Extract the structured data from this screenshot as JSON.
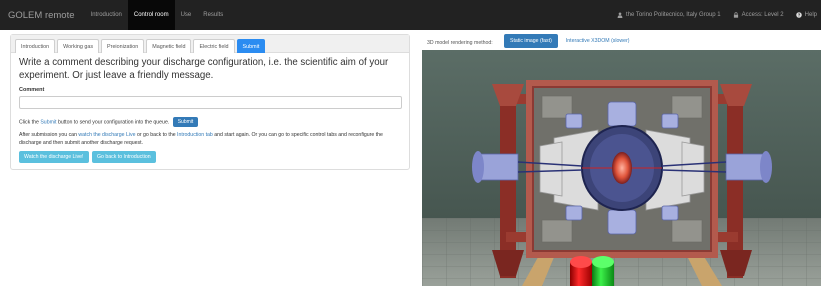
{
  "navbar": {
    "brand": "GOLEM remote",
    "items": [
      {
        "label": "Introduction",
        "active": false
      },
      {
        "label": "Control room",
        "active": true
      },
      {
        "label": "Use",
        "active": false
      },
      {
        "label": "Results",
        "active": false
      }
    ],
    "user": "the Torino Politecnico, Italy Group 1",
    "access": "Access: Level 2",
    "help": "Help",
    "user_icon": "user-icon",
    "access_icon": "lock-icon",
    "help_icon": "question-circle-icon"
  },
  "tabs": [
    {
      "label": "Introduction",
      "active": false
    },
    {
      "label": "Working gas",
      "active": false
    },
    {
      "label": "Preionization",
      "active": false
    },
    {
      "label": "Magnetic field",
      "active": false
    },
    {
      "label": "Electric field",
      "active": false
    },
    {
      "label": "Submit",
      "active": true
    }
  ],
  "form": {
    "heading": "Write a comment describing your discharge configuration, i.e. the scientific aim of your experiment. Or just leave a friendly message.",
    "comment_label": "Comment",
    "comment_value": "",
    "line1_pre": "Click the ",
    "line1_link": "Submit",
    "line1_post": " button to send your configuration into the queue.",
    "submit_button": "Submit",
    "line2_a": "After submission you can ",
    "line2_link1": "watch the discharge Live",
    "line2_b": " or go back to the ",
    "line2_link2": "Introduction tab",
    "line2_c": " and start again. Or you can go to specific control tabs and reconfigure the",
    "line3": "discharge and then submit another discharge request.",
    "watch_button": "Watch the discharge Live!",
    "back_button": "Go back to Introduction"
  },
  "render": {
    "label": "3D model rendering method:",
    "options": [
      {
        "label": "Static image (fast)",
        "active": true
      },
      {
        "label": "Interactive X3DOM (slower)",
        "active": false
      }
    ]
  },
  "colors": {
    "navbar_bg": "#222222",
    "primary": "#337ab7",
    "info": "#5bc0de",
    "tab_active": "#2b8cf1"
  }
}
